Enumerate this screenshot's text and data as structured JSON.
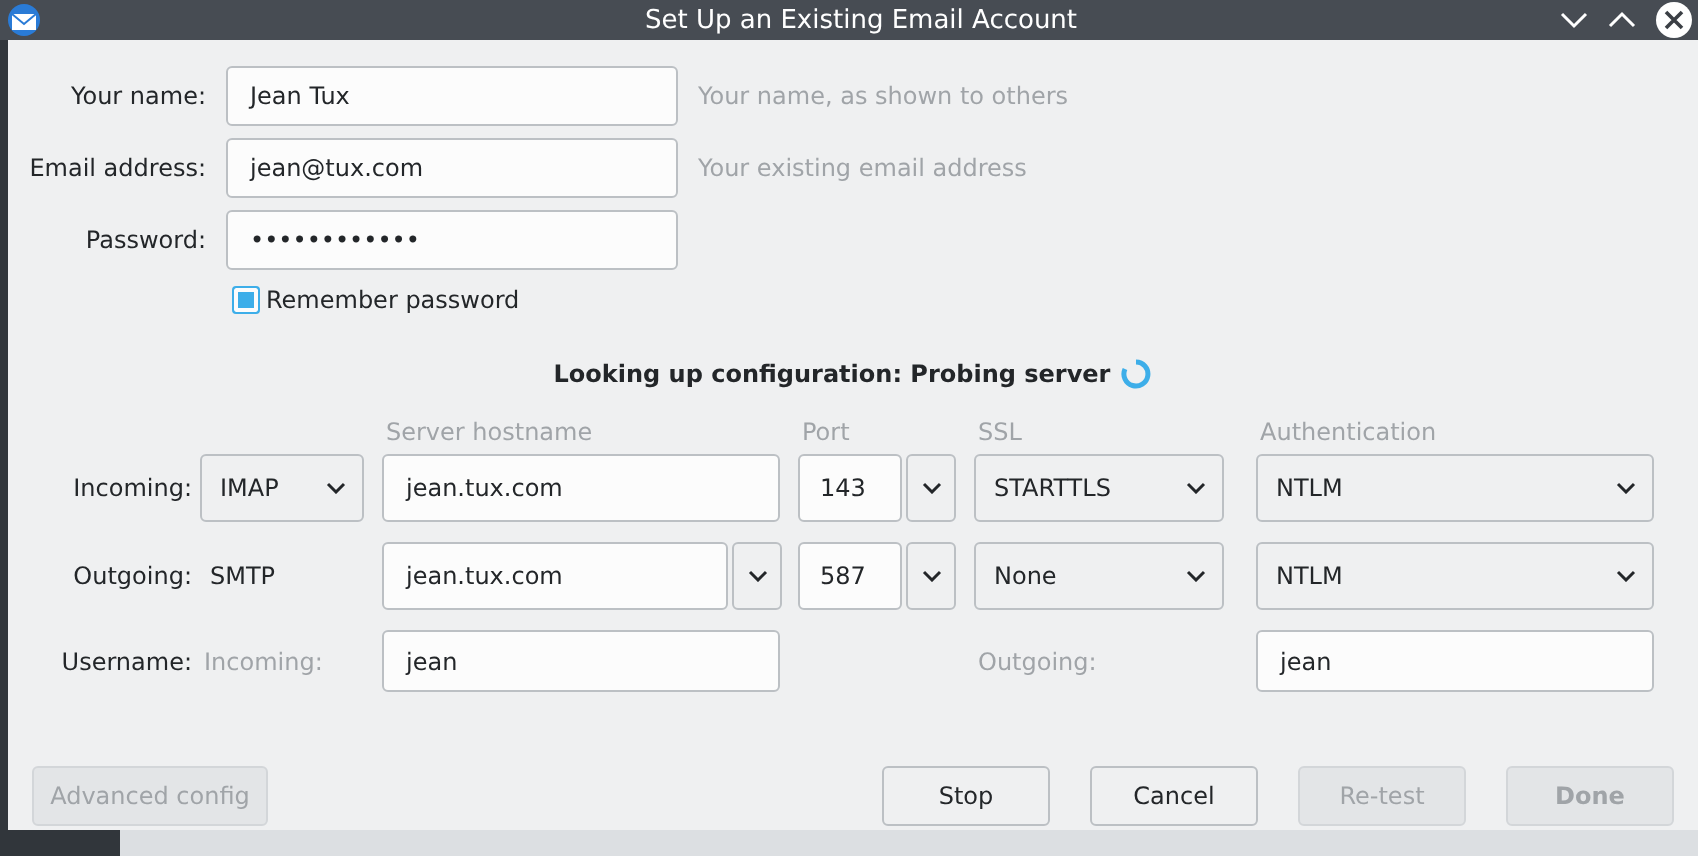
{
  "window": {
    "title": "Set Up an Existing Email Account"
  },
  "identity": [
    {
      "label": "Your name:",
      "value": "Jean Tux",
      "hint": "Your name, as shown to others"
    },
    {
      "label": "Email address:",
      "value": "jean@tux.com",
      "hint": "Your existing email address"
    },
    {
      "label": "Password:",
      "value": "••••••••••••"
    }
  ],
  "remember_password": {
    "label": "Remember password",
    "checked": true
  },
  "status": "Looking up configuration: Probing server",
  "server_headers": [
    "Server hostname",
    "Port",
    "SSL",
    "Authentication"
  ],
  "incoming": {
    "label": "Incoming:",
    "protocol": "IMAP",
    "hostname": "jean.tux.com",
    "port": "143",
    "ssl": "STARTTLS",
    "authentication": "NTLM"
  },
  "outgoing": {
    "label": "Outgoing:",
    "protocol": "SMTP",
    "hostname": "jean.tux.com",
    "port": "587",
    "ssl": "None",
    "authentication": "NTLM"
  },
  "username": {
    "label": "Username:",
    "incoming_label": "Incoming:",
    "incoming": "jean",
    "outgoing_label": "Outgoing:",
    "outgoing": "jean"
  },
  "buttons": [
    {
      "label": "Advanced config",
      "disabled": true,
      "default": false
    },
    {
      "label": "Stop",
      "disabled": false,
      "default": false
    },
    {
      "label": "Cancel",
      "disabled": false,
      "default": false
    },
    {
      "label": "Re-test",
      "disabled": true,
      "default": false
    },
    {
      "label": "Done",
      "disabled": true,
      "default": true
    }
  ]
}
